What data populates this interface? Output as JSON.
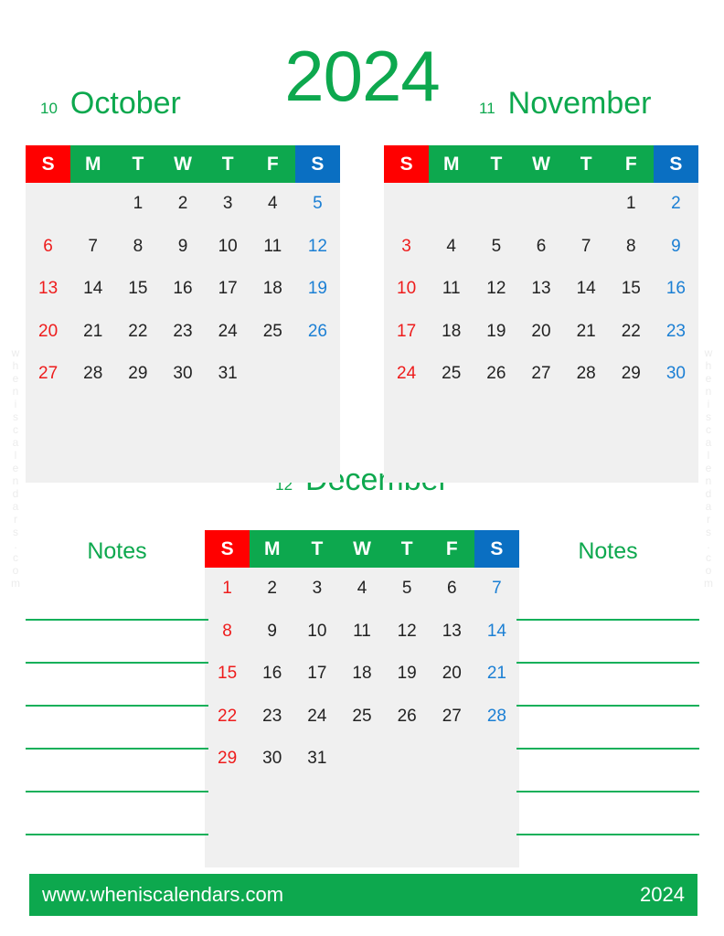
{
  "page": {
    "year_title": "2024",
    "brand_accent": "#0DA84E",
    "sunday_color": "#FF0000",
    "saturday_color": "#0A6FC2",
    "grid_background": "#f0f0f0"
  },
  "watermark": {
    "text": "wheniscalendars.com",
    "chars": [
      "w",
      "h",
      "e",
      "n",
      "i",
      "s",
      "c",
      "a",
      "l",
      "e",
      "n",
      "d",
      "a",
      "r",
      "s",
      ".",
      "c",
      "o",
      "m"
    ]
  },
  "months": [
    {
      "number": "10",
      "name": "October",
      "dow": [
        "S",
        "M",
        "T",
        "W",
        "T",
        "F",
        "S"
      ],
      "weeks": [
        [
          "",
          "",
          "1",
          "2",
          "3",
          "4",
          "5"
        ],
        [
          "6",
          "7",
          "8",
          "9",
          "10",
          "11",
          "12"
        ],
        [
          "13",
          "14",
          "15",
          "16",
          "17",
          "18",
          "19"
        ],
        [
          "20",
          "21",
          "22",
          "23",
          "24",
          "25",
          "26"
        ],
        [
          "27",
          "28",
          "29",
          "30",
          "31",
          "",
          ""
        ],
        [
          "",
          "",
          "",
          "",
          "",
          "",
          ""
        ]
      ]
    },
    {
      "number": "11",
      "name": "November",
      "dow": [
        "S",
        "M",
        "T",
        "W",
        "T",
        "F",
        "S"
      ],
      "weeks": [
        [
          "",
          "",
          "",
          "",
          "",
          "1",
          "2"
        ],
        [
          "3",
          "4",
          "5",
          "6",
          "7",
          "8",
          "9"
        ],
        [
          "10",
          "11",
          "12",
          "13",
          "14",
          "15",
          "16"
        ],
        [
          "17",
          "18",
          "19",
          "20",
          "21",
          "22",
          "23"
        ],
        [
          "24",
          "25",
          "26",
          "27",
          "28",
          "29",
          "30"
        ],
        [
          "",
          "",
          "",
          "",
          "",
          "",
          ""
        ]
      ]
    },
    {
      "number": "12",
      "name": "December",
      "dow": [
        "S",
        "M",
        "T",
        "W",
        "T",
        "F",
        "S"
      ],
      "weeks": [
        [
          "1",
          "2",
          "3",
          "4",
          "5",
          "6",
          "7"
        ],
        [
          "8",
          "9",
          "10",
          "11",
          "12",
          "13",
          "14"
        ],
        [
          "15",
          "16",
          "17",
          "18",
          "19",
          "20",
          "21"
        ],
        [
          "22",
          "23",
          "24",
          "25",
          "26",
          "27",
          "28"
        ],
        [
          "29",
          "30",
          "31",
          "",
          "",
          "",
          ""
        ],
        [
          "",
          "",
          "",
          "",
          "",
          "",
          ""
        ]
      ]
    }
  ],
  "notes": {
    "left_title": "Notes",
    "right_title": "Notes",
    "line_count": 6
  },
  "footer": {
    "site": "www.wheniscalendars.com",
    "year": "2024"
  }
}
